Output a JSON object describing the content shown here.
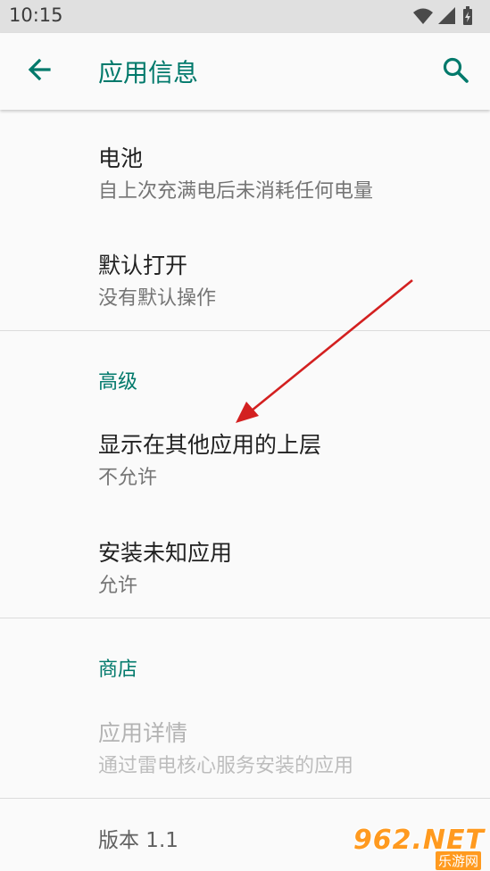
{
  "status_bar": {
    "time": "10:15",
    "icons": [
      "wifi-icon",
      "signal-icon",
      "battery-icon"
    ]
  },
  "app_bar": {
    "title": "应用信息",
    "back_icon": "arrow-back-icon",
    "search_icon": "search-icon"
  },
  "items": {
    "battery": {
      "title": "电池",
      "subtitle": "自上次充满电后未消耗任何电量"
    },
    "default_open": {
      "title": "默认打开",
      "subtitle": "没有默认操作"
    },
    "overlay": {
      "title": "显示在其他应用的上层",
      "subtitle": "不允许"
    },
    "install_unknown": {
      "title": "安装未知应用",
      "subtitle": "允许"
    },
    "app_details": {
      "title": "应用详情",
      "subtitle": "通过雷电核心服务安装的应用"
    }
  },
  "sections": {
    "advanced": "高级",
    "store": "商店"
  },
  "version": "版本 1.1",
  "watermark": {
    "logo": "962.NET",
    "sub": "乐游网"
  },
  "colors": {
    "accent": "#00796b",
    "annotation_arrow": "#d32020",
    "watermark": "#ff9a1f"
  }
}
